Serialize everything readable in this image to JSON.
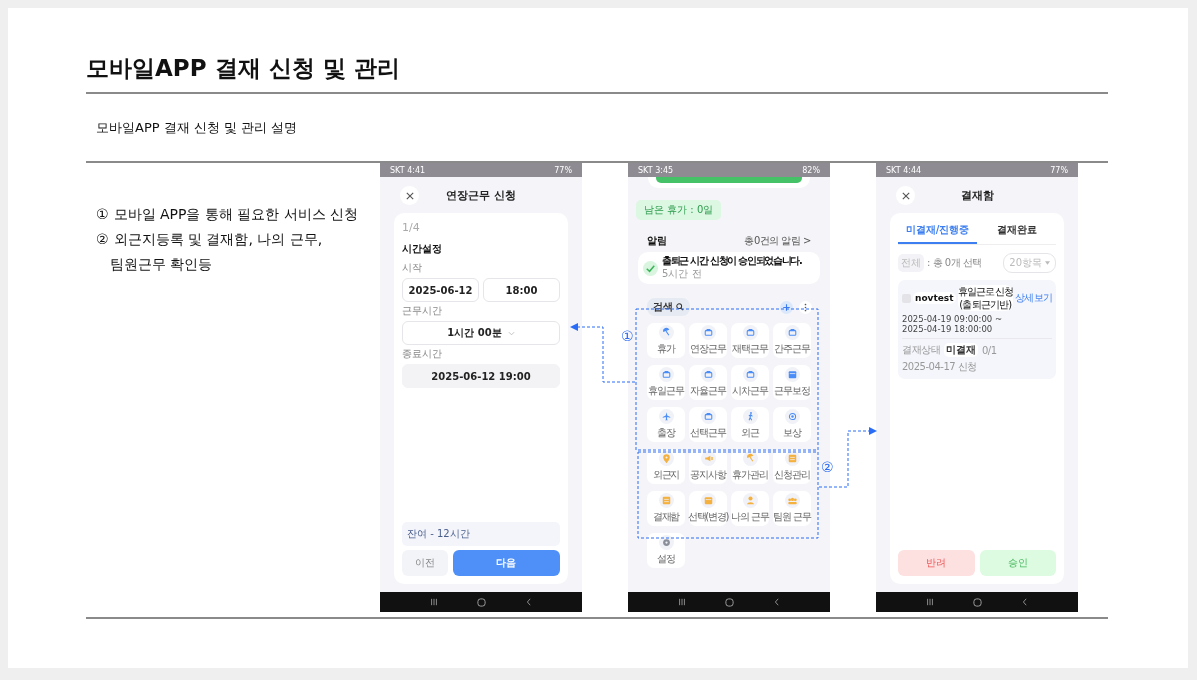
{
  "title": "모바일APP 결재 신청 및 관리",
  "subtitle": "모바일APP 결재 신청 및 관리 설명",
  "steps": [
    {
      "marker": "①",
      "lines": [
        "모바일 APP을 통해 필요한 서비스 신청"
      ]
    },
    {
      "marker": "②",
      "lines": [
        "외근지등록 및 결재함, 나의 근무,",
        "팀원근무 확인등"
      ]
    }
  ],
  "phones": [
    {
      "kind": "form",
      "status_time": "SKT 4:41",
      "battery": "77%",
      "title": "연장근무 신청",
      "step": "1/4",
      "section": "시간설정",
      "start_label": "시작",
      "start_date": "2025-06-12",
      "start_time": "18:00",
      "duration_label": "근무시간",
      "duration": "1시간 00분",
      "end_label": "종료시간",
      "end": "2025-06-12 19:00",
      "remaining": "잔여 - 12시간",
      "buttons": [
        {
          "label": "이전",
          "primary": false
        },
        {
          "label": "다음",
          "primary": true
        }
      ]
    },
    {
      "kind": "home",
      "status_time": "SKT 3:45",
      "battery": "82%",
      "leave": "남은 휴가 : 0일",
      "alerts_title": "알림",
      "alerts_link": "총0건의 알림 >",
      "notice": "출퇴근 시간 신청이 승인되었습니다.",
      "notice_time": "5시간 전",
      "search": "검색",
      "groups": [
        {
          "color": "#4a8df8",
          "items": [
            "휴가",
            "연장근무",
            "재택근무",
            "간주근무",
            "휴일근무",
            "자율근무",
            "시차근무",
            "근무보정",
            "출장",
            "선택근무",
            "외근",
            "보상"
          ]
        },
        {
          "color": "#f5b13d",
          "items": [
            "외근지",
            "공지사항",
            "휴가관리",
            "신청관리",
            "결재함",
            "선택(변경)",
            "나의 근무",
            "팀원 근무"
          ]
        },
        {
          "color": "#8a8f99",
          "items": [
            "설정"
          ]
        }
      ]
    },
    {
      "kind": "approvals",
      "status_time": "SKT 4:44",
      "battery": "77%",
      "title": "결재함",
      "tabs": [
        {
          "label": "미결재/진행중",
          "selected": true
        },
        {
          "label": "결재완료",
          "selected": false
        }
      ],
      "all": "전체",
      "selected_count": ": 총 0개 선택",
      "page_size": "20항목",
      "items": [
        {
          "checked": false,
          "user": "novtest",
          "type": "휴일근로신청 (출퇴근기반)",
          "link": "상세보기",
          "period_start": "2025-04-19 09:00:00 ~",
          "period_end": "2025-04-19 18:00:00",
          "state_label": "결재상태",
          "state": "미결재",
          "progress": "0/1",
          "requested": "2025-04-17 신청"
        }
      ],
      "buttons": [
        {
          "label": "반려",
          "kind": "reject"
        },
        {
          "label": "승인",
          "kind": "approve"
        }
      ]
    }
  ],
  "callouts": [
    {
      "label": "①"
    },
    {
      "label": "②"
    }
  ]
}
